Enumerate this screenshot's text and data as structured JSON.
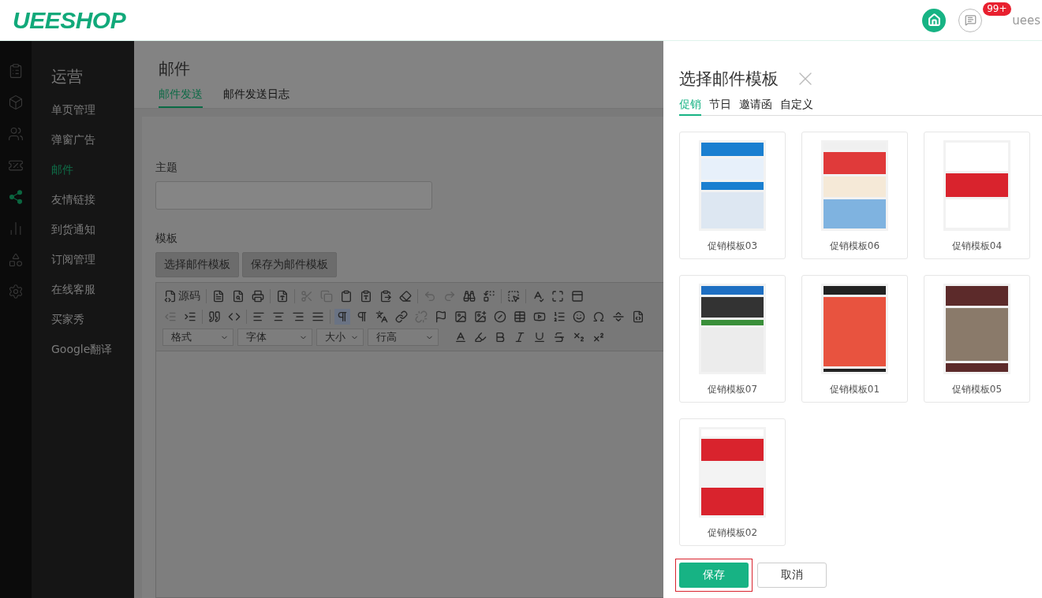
{
  "header": {
    "logo": "UEESHOP",
    "badge": "99+",
    "user": "uees"
  },
  "rail": [
    {
      "selected": false
    },
    {
      "selected": false
    },
    {
      "selected": false
    },
    {
      "selected": false
    },
    {
      "selected": true
    },
    {
      "selected": false
    },
    {
      "selected": false
    },
    {
      "selected": false
    }
  ],
  "sidebar": {
    "title": "运营",
    "items": [
      {
        "label": "单页管理",
        "selected": false
      },
      {
        "label": "弹窗广告",
        "selected": false
      },
      {
        "label": "邮件",
        "selected": true
      },
      {
        "label": "友情链接",
        "selected": false
      },
      {
        "label": "到货通知",
        "selected": false
      },
      {
        "label": "订阅管理",
        "selected": false
      },
      {
        "label": "在线客服",
        "selected": false
      },
      {
        "label": "买家秀",
        "selected": false
      },
      {
        "label": "Google翻译",
        "selected": false
      }
    ]
  },
  "page": {
    "title": "邮件",
    "tabs": [
      {
        "label": "邮件发送",
        "selected": true
      },
      {
        "label": "邮件发送日志",
        "selected": false
      }
    ],
    "subject_label": "主题",
    "template_label": "模板",
    "template_buttons": [
      "选择邮件模板",
      "保存为邮件模板"
    ],
    "editor": {
      "source_label": "源码",
      "selects": [
        "格式",
        "字体",
        "大小",
        "行高"
      ]
    }
  },
  "drawer": {
    "title": "选择邮件模板",
    "tabs": [
      {
        "label": "促销",
        "selected": true
      },
      {
        "label": "节日",
        "selected": false
      },
      {
        "label": "邀请函",
        "selected": false
      },
      {
        "label": "自定义",
        "selected": false
      }
    ],
    "templates": [
      {
        "name": "促销模板03",
        "kind": "blue"
      },
      {
        "name": "促销模板06",
        "kind": "light"
      },
      {
        "name": "促销模板04",
        "kind": "banner"
      },
      {
        "name": "促销模板07",
        "kind": "tech"
      },
      {
        "name": "促销模板01",
        "kind": "sale"
      },
      {
        "name": "促销模板05",
        "kind": "room"
      },
      {
        "name": "促销模板02",
        "kind": "red"
      }
    ],
    "save": "保存",
    "cancel": "取消"
  }
}
